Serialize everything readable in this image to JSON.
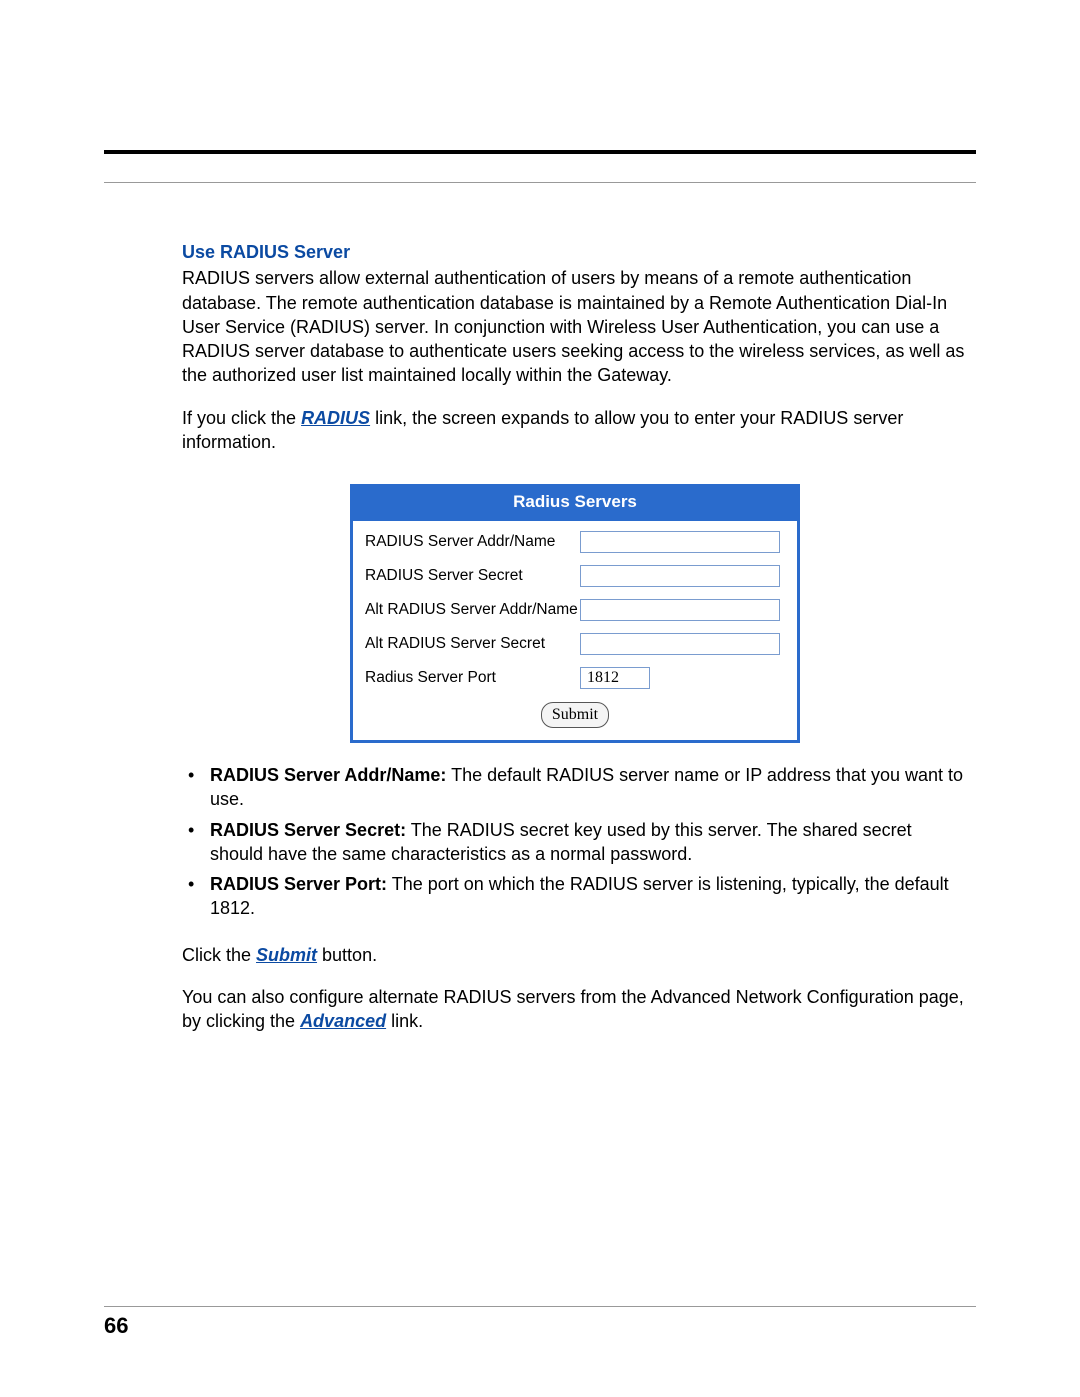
{
  "page_number": "66",
  "section_heading": "Use RADIUS Server",
  "intro_paragraph": "RADIUS servers allow external authentication of users by means of a remote authentication database. The remote authentication database is maintained by a Remote Authentication Dial-In User Service (RADIUS) server. In conjunction with Wireless User Authentication, you can use a RADIUS server database to authenticate users seeking access to the wireless services, as well as the authorized user list maintained locally within the Gateway.",
  "click_radius_prefix": "If you click the ",
  "radius_link_text": "RADIUS",
  "click_radius_suffix": " link, the screen expands to allow you to enter your RADIUS server information.",
  "figure": {
    "title": "Radius Servers",
    "rows": [
      {
        "label": "RADIUS Server Addr/Name",
        "value": "",
        "short": false
      },
      {
        "label": "RADIUS Server Secret",
        "value": "",
        "short": false
      },
      {
        "label": "Alt RADIUS Server Addr/Name",
        "value": "",
        "short": false
      },
      {
        "label": "Alt RADIUS Server Secret",
        "value": "",
        "short": false
      },
      {
        "label": "Radius Server Port",
        "value": "1812",
        "short": true
      }
    ],
    "submit_label": "Submit"
  },
  "bullets": [
    {
      "term": "RADIUS Server Addr/Name:",
      "desc": " The default RADIUS server name or IP address that you want to use."
    },
    {
      "term": "RADIUS Server Secret:",
      "desc": " The RADIUS secret key used by this server. The shared secret should have the same characteristics as a normal password."
    },
    {
      "term": "RADIUS Server Port:",
      "desc": " The port on which the RADIUS server is listening, typically, the default 1812."
    }
  ],
  "click_submit_prefix": "Click the ",
  "submit_link_text": "Submit",
  "click_submit_suffix": " button.",
  "advanced_prefix": "You can also configure alternate RADIUS servers from the Advanced Network Configuration page, by clicking the ",
  "advanced_link_text": "Advanced",
  "advanced_suffix": " link."
}
